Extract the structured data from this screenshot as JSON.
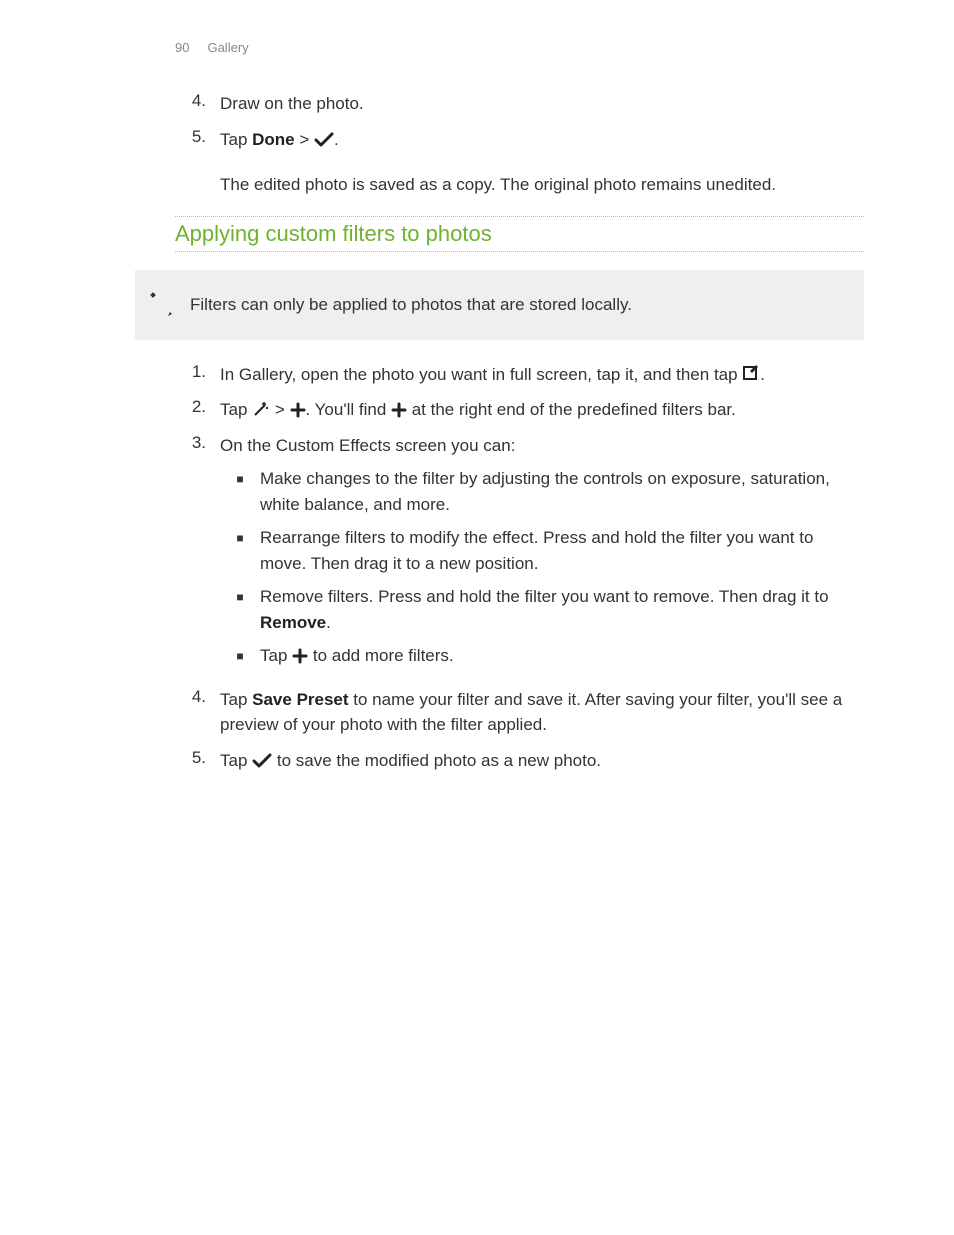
{
  "header": {
    "page_num": "90",
    "section": "Gallery"
  },
  "top_steps": {
    "s4": {
      "num": "4.",
      "text": "Draw on the photo."
    },
    "s5": {
      "num": "5.",
      "pre": "Tap ",
      "done": "Done",
      "gt": " > ",
      "period": "."
    },
    "note": "The edited photo is saved as a copy. The original photo remains unedited."
  },
  "section_title": "Applying custom filters to photos",
  "infobox": "Filters can only be applied to photos that are stored locally.",
  "steps": {
    "s1": {
      "num": "1.",
      "a": "In Gallery, open the photo you want in full screen, tap it, and then tap ",
      "b": "."
    },
    "s2": {
      "num": "2.",
      "a": "Tap ",
      "gt": " > ",
      "b": ". You'll find ",
      "c": " at the right end of the predefined filters bar."
    },
    "s3": {
      "num": "3.",
      "a": "On the Custom Effects screen you can:"
    },
    "bullets": {
      "b1": "Make changes to the filter by adjusting the controls on exposure, saturation, white balance, and more.",
      "b2": "Rearrange filters to modify the effect. Press and hold the filter you want to move. Then drag it to a new position.",
      "b3a": "Remove filters. Press and hold the filter you want to remove. Then drag it to ",
      "b3b": "Remove",
      "b3c": ".",
      "b4a": "Tap ",
      "b4b": " to add more filters."
    },
    "s4": {
      "num": "4.",
      "a": "Tap ",
      "b": "Save Preset",
      "c": " to name your filter and save it. After saving your filter, you'll see a preview of your photo with the filter applied."
    },
    "s5": {
      "num": "5.",
      "a": "Tap ",
      "b": " to save the modified photo as a new photo."
    }
  }
}
